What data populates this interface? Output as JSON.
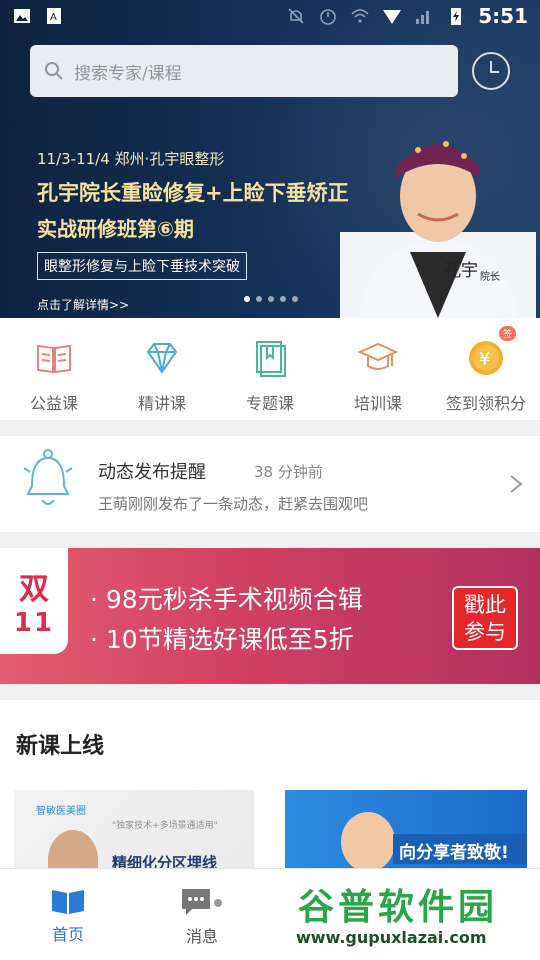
{
  "status_bar": {
    "time": "5:51"
  },
  "search": {
    "placeholder": "搜索专家/课程"
  },
  "hero_banner": {
    "line1": "11/3-11/4 郑州·孔宇眼整形",
    "title": "孔宇院长重睑修复+上睑下垂矫正",
    "subtitle": "实战研修班第⑥期",
    "box_text": "眼整形修复与上睑下垂技术突破",
    "more": "点击了解详情>>",
    "signature": "孔宇",
    "role": "院长"
  },
  "categories": [
    {
      "label": "公益课",
      "icon": "book-open-icon",
      "color": "#e9827b"
    },
    {
      "label": "精讲课",
      "icon": "diamond-icon",
      "color": "#4fa9d8"
    },
    {
      "label": "专题课",
      "icon": "notebook-icon",
      "color": "#49b59b"
    },
    {
      "label": "培训课",
      "icon": "graduation-cap-icon",
      "color": "#e7905f"
    },
    {
      "label": "签到领积分",
      "icon": "coin-icon",
      "color": "#f3b12a",
      "badge": "签"
    }
  ],
  "notice": {
    "title": "动态发布提醒",
    "time": "38 分钟前",
    "desc": "王萌刚刚发布了一条动态，赶紧去围观吧"
  },
  "promo": {
    "tag_line1": "双",
    "tag_line2": "11",
    "line1": "· 98元秒杀手术视频合辑",
    "line2": "· 10节精选好课低至5折",
    "cta": "戳此参与"
  },
  "new_courses": {
    "heading": "新课上线",
    "card1_logo": "智敏医美圈",
    "card1_small": "\"独家技术+多场景通适用\"",
    "card1_title": "精细化分区埋线",
    "card2_title": "向分享者致敬!"
  },
  "bottom_nav": {
    "home": "首页",
    "messages": "消息"
  },
  "watermark": {
    "title": "谷普软件园",
    "url": "www.gupuxlazai.com"
  }
}
